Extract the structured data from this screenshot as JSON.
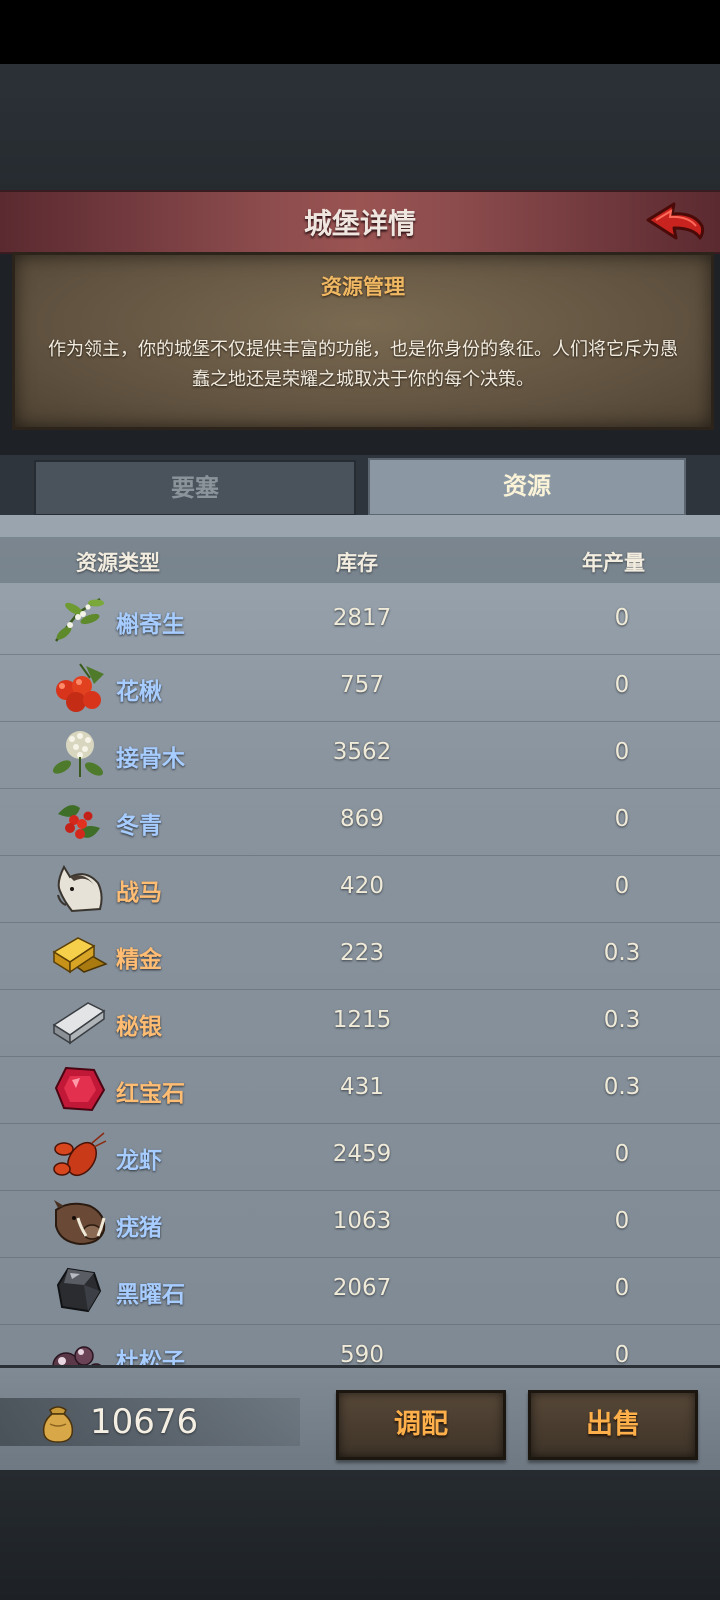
{
  "title": "城堡详情",
  "intro": {
    "heading": "资源管理",
    "description": "作为领主，你的城堡不仅提供丰富的功能，也是你身份的象征。人们将它斥为愚蠢之地还是荣耀之城取决于你的每个决策。"
  },
  "tabs": [
    {
      "label": "要塞",
      "active": false
    },
    {
      "label": "资源",
      "active": true
    }
  ],
  "table": {
    "headers": {
      "type": "资源类型",
      "stock": "库存",
      "yield": "年产量"
    },
    "rows": [
      {
        "name": "槲寄生",
        "stock": "2817",
        "yield": "0",
        "icon": "mistletoe-icon",
        "name_color": "blue"
      },
      {
        "name": "花楸",
        "stock": "757",
        "yield": "0",
        "icon": "rowan-berries-icon",
        "name_color": "blue"
      },
      {
        "name": "接骨木",
        "stock": "3562",
        "yield": "0",
        "icon": "elderflower-icon",
        "name_color": "blue"
      },
      {
        "name": "冬青",
        "stock": "869",
        "yield": "0",
        "icon": "holly-icon",
        "name_color": "blue"
      },
      {
        "name": "战马",
        "stock": "420",
        "yield": "0",
        "icon": "warhorse-icon",
        "name_color": "orange"
      },
      {
        "name": "精金",
        "stock": "223",
        "yield": "0.3",
        "icon": "gold-ingot-icon",
        "name_color": "orange"
      },
      {
        "name": "秘银",
        "stock": "1215",
        "yield": "0.3",
        "icon": "mithril-ingot-icon",
        "name_color": "orange"
      },
      {
        "name": "红宝石",
        "stock": "431",
        "yield": "0.3",
        "icon": "ruby-icon",
        "name_color": "orange"
      },
      {
        "name": "龙虾",
        "stock": "2459",
        "yield": "0",
        "icon": "lobster-icon",
        "name_color": "blue"
      },
      {
        "name": "疣猪",
        "stock": "1063",
        "yield": "0",
        "icon": "warthog-icon",
        "name_color": "blue"
      },
      {
        "name": "黑曜石",
        "stock": "2067",
        "yield": "0",
        "icon": "obsidian-icon",
        "name_color": "blue"
      },
      {
        "name": "杜松子",
        "stock": "590",
        "yield": "0",
        "icon": "juniper-berries-icon",
        "name_color": "blue"
      }
    ]
  },
  "footer": {
    "gold": "10676",
    "gold_icon": "gold-sack-icon",
    "allocate_label": "调配",
    "sell_label": "出售"
  },
  "colors": {
    "banner": "#8a4a4c",
    "name_blue": "#a7ccff",
    "name_orange": "#ffbd73",
    "button_text": "#ffb04a"
  }
}
